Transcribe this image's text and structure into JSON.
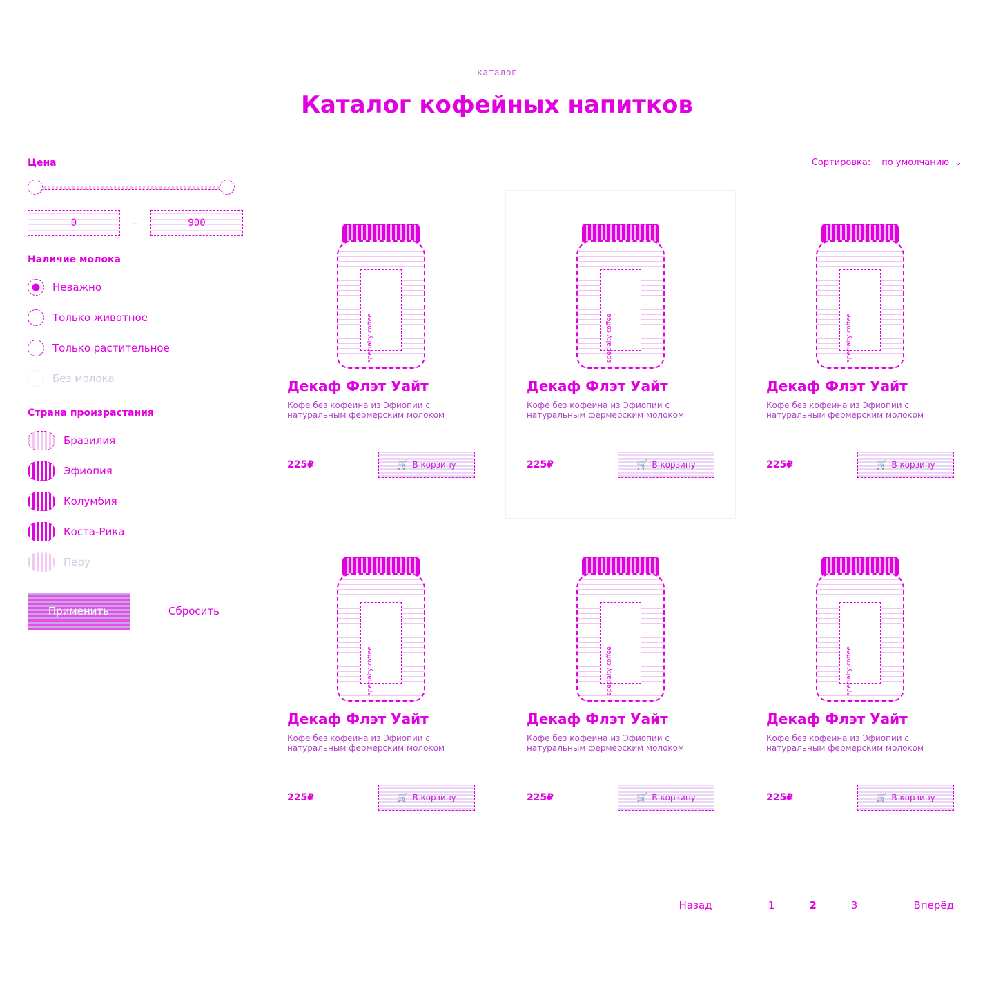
{
  "header": {
    "eyebrow": "каталог",
    "title": "Каталог кофейных напитков"
  },
  "filters": {
    "price": {
      "title": "Цена",
      "min": "0",
      "max": "900"
    },
    "milk": {
      "title": "Наличие молока",
      "options": [
        {
          "label": "Неважно",
          "checked": true,
          "disabled": false
        },
        {
          "label": "Только животное",
          "checked": false,
          "disabled": false
        },
        {
          "label": "Только растительное",
          "checked": false,
          "disabled": false
        },
        {
          "label": "Без молока",
          "checked": false,
          "disabled": true
        }
      ]
    },
    "country": {
      "title": "Страна произрастания",
      "options": [
        {
          "label": "Бразилия",
          "checked": false,
          "disabled": false
        },
        {
          "label": "Эфиопия",
          "checked": true,
          "disabled": false
        },
        {
          "label": "Колумбия",
          "checked": true,
          "disabled": false
        },
        {
          "label": "Коста-Рика",
          "checked": true,
          "disabled": false
        },
        {
          "label": "Перу",
          "checked": false,
          "disabled": true
        }
      ]
    },
    "apply_label": "Применить",
    "reset_label": "Сбросить"
  },
  "sort": {
    "label": "Сортировка:",
    "value": "по умолчанию"
  },
  "products": [
    {
      "title": "Декаф Флэт Уайт",
      "desc": "Кофе без кофеина из Эфиопии с натуральным фермерским молоком",
      "price": "225₽",
      "cart_label": "В корзину",
      "jar_text": "specialty coffee"
    },
    {
      "title": "Декаф Флэт Уайт",
      "desc": "Кофе без кофеина из Эфиопии с натуральным фермерским молоком",
      "price": "225₽",
      "cart_label": "В корзину",
      "jar_text": "specialty coffee"
    },
    {
      "title": "Декаф Флэт Уайт",
      "desc": "Кофе без кофеина из Эфиопии с натуральным фермерским молоком",
      "price": "225₽",
      "cart_label": "В корзину",
      "jar_text": "specialty coffee"
    },
    {
      "title": "Декаф Флэт Уайт",
      "desc": "Кофе без кофеина из Эфиопии с натуральным фермерским молоком",
      "price": "225₽",
      "cart_label": "В корзину",
      "jar_text": "specialty coffee"
    },
    {
      "title": "Декаф Флэт Уайт",
      "desc": "Кофе без кофеина из Эфиопии с натуральным фермерским молоком",
      "price": "225₽",
      "cart_label": "В корзину",
      "jar_text": "specialty coffee"
    },
    {
      "title": "Декаф Флэт Уайт",
      "desc": "Кофе без кофеина из Эфиопии с натуральным фермерским молоком",
      "price": "225₽",
      "cart_label": "В корзину",
      "jar_text": "specialty coffee"
    }
  ],
  "pagination": {
    "prev": "Назад",
    "pages": [
      "1",
      "2",
      "3"
    ],
    "current": "2",
    "next": "Вперёд"
  },
  "icons": {
    "cart": "cart-icon",
    "sort_chevron": "chevron-down-icon"
  }
}
